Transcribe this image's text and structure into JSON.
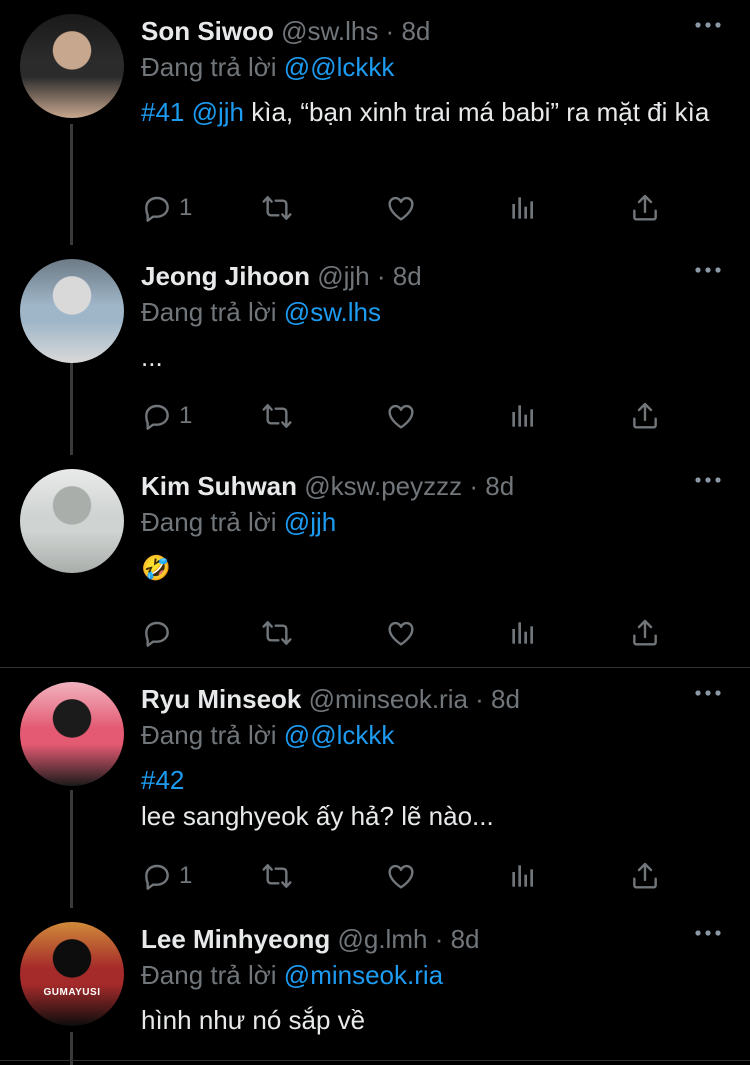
{
  "tweets": [
    {
      "name": "Son Siwoo",
      "handle": "@sw.lhs",
      "time": "8d",
      "reply_prefix": "Đang trả lời",
      "reply_to": "@@lckkk",
      "text_parts": [
        {
          "text": "#41 @jjh",
          "style": "link"
        },
        {
          "text": " kìa, “bạn xinh trai má babi” ra mặt đi kìa",
          "style": "plain"
        }
      ],
      "replies": "1",
      "avatar_colors": [
        "#2b2b2b",
        "#c8a78f",
        "#1a1a1a"
      ]
    },
    {
      "name": "Jeong Jihoon",
      "handle": "@jjh",
      "time": "8d",
      "reply_prefix": "Đang trả lời",
      "reply_to": "@sw.lhs",
      "text_parts": [
        {
          "text": "...",
          "style": "plain"
        }
      ],
      "replies": "1",
      "avatar_colors": [
        "#9fb6c8",
        "#d9d9d9",
        "#6c7a86"
      ]
    },
    {
      "name": "Kim Suhwan",
      "handle": "@ksw.peyzzz",
      "time": "8d",
      "reply_prefix": "Đang trả lời",
      "reply_to": "@jjh",
      "text_parts": [
        {
          "text": "🤣",
          "style": "emoji"
        }
      ],
      "replies": "",
      "avatar_colors": [
        "#cfd3d1",
        "#a9aeab",
        "#e9ebea"
      ]
    },
    {
      "name": "Ryu Minseok",
      "handle": "@minseok.ria",
      "time": "8d",
      "reply_prefix": "Đang trả lời",
      "reply_to": "@@lckkk",
      "text_parts": [
        {
          "text": "#42",
          "style": "link"
        },
        {
          "text": "lee sanghyeok ấy hả? lẽ nào...",
          "style": "plain-block"
        }
      ],
      "replies": "1",
      "avatar_colors": [
        "#e35a72",
        "#1b1b1b",
        "#f2b3c0"
      ]
    },
    {
      "name": "Lee Minhyeong",
      "handle": "@g.lmh",
      "time": "8d",
      "reply_prefix": "Đang trả lời",
      "reply_to": "@minseok.ria",
      "text_parts": [
        {
          "text": "hình như nó sắp về",
          "style": "plain"
        }
      ],
      "replies": "",
      "avatar_colors": [
        "#a52a2a",
        "#0d0d0d",
        "#d08a3a"
      ],
      "avatar_text": "GUMAYUSI"
    }
  ],
  "icons": {
    "reply": "comment-icon",
    "retweet": "retweet-icon",
    "like": "heart-icon",
    "views": "analytics-icon",
    "share": "share-icon",
    "more": "more-dots-icon"
  },
  "colors": {
    "background": "#000000",
    "link": "#1d9bf0",
    "secondary": "#71767b",
    "primary": "#e7e9ea"
  }
}
